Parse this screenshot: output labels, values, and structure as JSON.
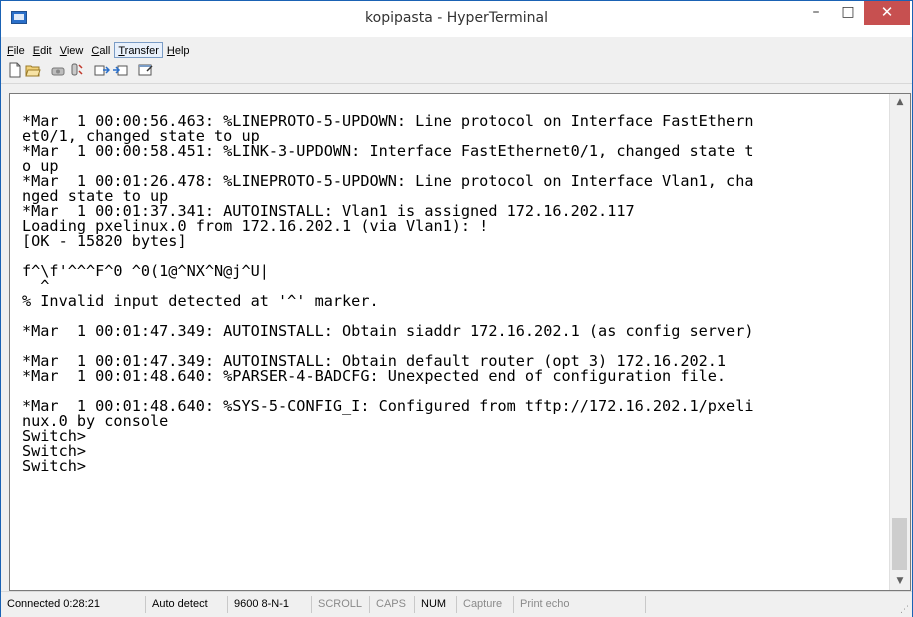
{
  "window": {
    "title": "kopipasta - HyperTerminal",
    "controls": {
      "minimize": "–",
      "maximize": "□",
      "close": "✕"
    }
  },
  "menu": {
    "file": {
      "mnemonic": "F",
      "rest": "ile"
    },
    "edit": {
      "mnemonic": "E",
      "rest": "dit"
    },
    "view": {
      "mnemonic": "V",
      "rest": "iew"
    },
    "call": {
      "mnemonic": "C",
      "rest": "all"
    },
    "transfer": {
      "mnemonic": "T",
      "rest": "ransfer"
    },
    "help": {
      "mnemonic": "H",
      "rest": "elp"
    }
  },
  "toolbar": {
    "icons": [
      "new-icon",
      "open-icon",
      "connect-icon",
      "disconnect-icon",
      "send-icon",
      "receive-icon",
      "properties-icon"
    ]
  },
  "terminal": {
    "text": "*Mar  1 00:00:56.463: %LINEPROTO-5-UPDOWN: Line protocol on Interface FastEthern\net0/1, changed state to up\n*Mar  1 00:00:58.451: %LINK-3-UPDOWN: Interface FastEthernet0/1, changed state t\no up\n*Mar  1 00:01:26.478: %LINEPROTO-5-UPDOWN: Line protocol on Interface Vlan1, cha\nnged state to up\n*Mar  1 00:01:37.341: AUTOINSTALL: Vlan1 is assigned 172.16.202.117\nLoading pxelinux.0 from 172.16.202.1 (via Vlan1): !\n[OK - 15820 bytes]\n\nf^\\f'^^^F^0 ^0(1@^NX^N@j^U|\n  ^\n% Invalid input detected at '^' marker.\n\n*Mar  1 00:01:47.349: AUTOINSTALL: Obtain siaddr 172.16.202.1 (as config server)\n\n*Mar  1 00:01:47.349: AUTOINSTALL: Obtain default router (opt 3) 172.16.202.1\n*Mar  1 00:01:48.640: %PARSER-4-BADCFG: Unexpected end of configuration file.\n\n*Mar  1 00:01:48.640: %SYS-5-CONFIG_I: Configured from tftp://172.16.202.1/pxeli\nnux.0 by console\nSwitch>\nSwitch>\nSwitch>"
  },
  "statusbar": {
    "connected": "Connected 0:28:21",
    "detect": "Auto detect",
    "settings": "9600 8-N-1",
    "scroll": "SCROLL",
    "caps": "CAPS",
    "num": "NUM",
    "capture": "Capture",
    "print_echo": "Print echo"
  }
}
